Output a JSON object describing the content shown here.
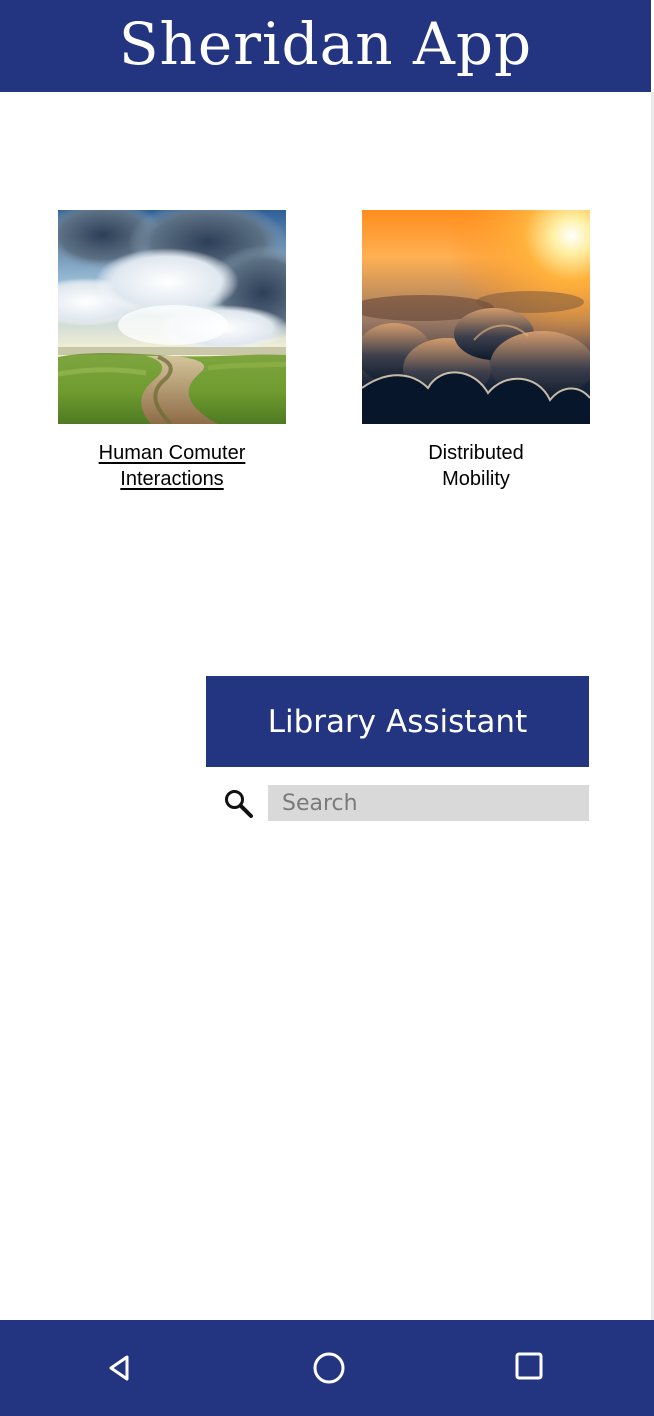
{
  "header": {
    "title": "Sheridan App"
  },
  "courses": [
    {
      "label_lines": [
        "Human Comuter",
        "Interactions"
      ],
      "image": "country-road-sky-photo",
      "underlined": true
    },
    {
      "label_lines": [
        "Distributed",
        "Mobility"
      ],
      "image": "sunset-above-clouds-photo",
      "underlined": false
    }
  ],
  "library": {
    "button_label": "Library Assistant"
  },
  "search": {
    "placeholder": "Search",
    "value": "",
    "icon": "search-icon"
  },
  "nav": {
    "back_icon": "back-triangle-icon",
    "home_icon": "home-circle-icon",
    "recent_icon": "recent-apps-square-icon"
  },
  "colors": {
    "brand": "#233580",
    "search_background": "#d9d9d9",
    "text": "#000000",
    "inverse_text": "#ffffff"
  }
}
